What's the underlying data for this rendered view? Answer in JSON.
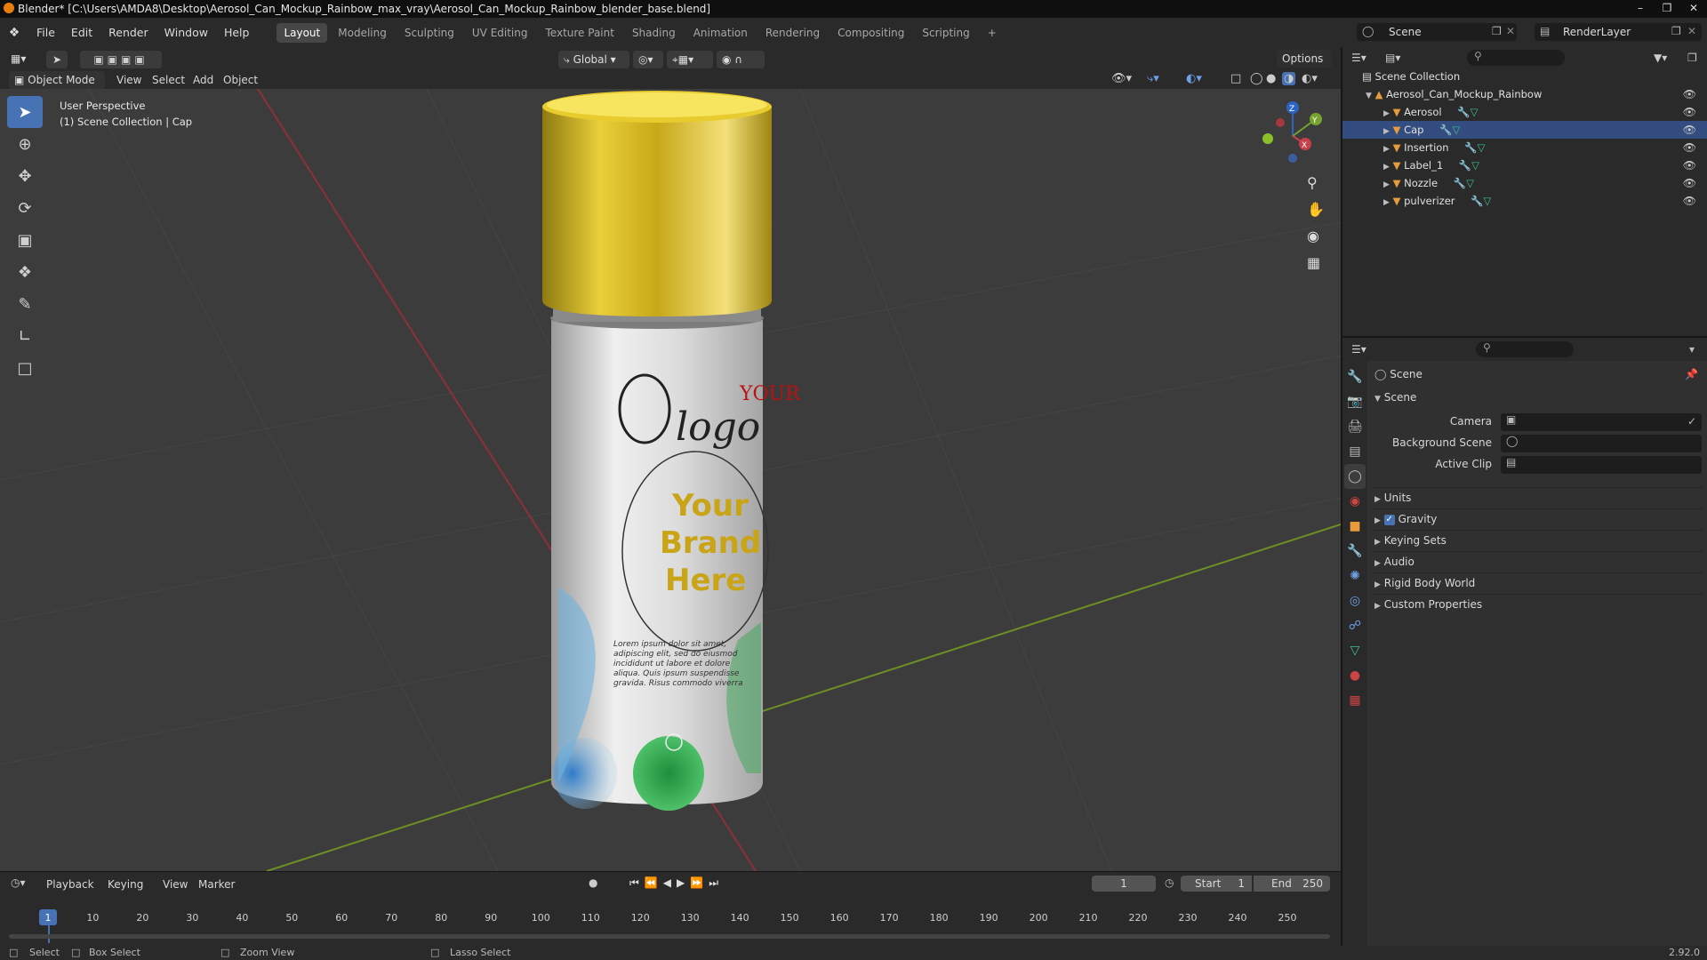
{
  "title_bar": {
    "text": "Blender* [C:\\Users\\AMDA8\\Desktop\\Aerosol_Can_Mockup_Rainbow_max_vray\\Aerosol_Can_Mockup_Rainbow_blender_base.blend]"
  },
  "menu": {
    "items": [
      "File",
      "Edit",
      "Render",
      "Window",
      "Help"
    ]
  },
  "workspaces": [
    "Layout",
    "Modeling",
    "Sculpting",
    "UV Editing",
    "Texture Paint",
    "Shading",
    "Animation",
    "Rendering",
    "Compositing",
    "Scripting",
    "+"
  ],
  "top_right": {
    "scene": "Scene",
    "view_layer": "RenderLayer"
  },
  "viewport_header": {
    "mode": "Object Mode",
    "menus": [
      "View",
      "Select",
      "Add",
      "Object"
    ],
    "transform_orientation": "Global",
    "options": "Options"
  },
  "viewport": {
    "perspective": "User Perspective",
    "collection_info": "(1) Scene Collection | Cap",
    "label_text": {
      "logo_line1": "YOUR",
      "logo_line2": "logo",
      "brand_line1": "Your",
      "brand_line2": "Brand",
      "brand_line3": "Here",
      "lorem": "Lorem ipsum dolor sit amet, adipiscing elit, sed do eiusmod incididunt ut labore et dolore aliqua. Quis ipsum suspendisse gravida. Risus commodo viverra"
    },
    "gizmo": {
      "z": "Z",
      "y": "Y",
      "x": "X"
    }
  },
  "outliner": {
    "root": "Scene Collection",
    "collection": "Aerosol_Can_Mockup_Rainbow",
    "objects": [
      "Aerosol",
      "Cap",
      "Insertion",
      "Label_1",
      "Nozzle",
      "pulverizer"
    ]
  },
  "properties": {
    "header": "Scene",
    "section": "Scene",
    "fields": [
      {
        "label": "Camera"
      },
      {
        "label": "Background Scene"
      },
      {
        "label": "Active Clip"
      }
    ],
    "panels": [
      "Units",
      "Gravity",
      "Keying Sets",
      "Audio",
      "Rigid Body World",
      "Custom Properties"
    ],
    "gravity_checked": true
  },
  "timeline": {
    "menus": [
      "Playback",
      "Keying",
      "View",
      "Marker"
    ],
    "current_frame": "1",
    "start_label": "Start",
    "start": "1",
    "end_label": "End",
    "end": "250",
    "ticks": [
      "1",
      "10",
      "20",
      "30",
      "40",
      "50",
      "60",
      "70",
      "80",
      "90",
      "100",
      "110",
      "120",
      "130",
      "140",
      "150",
      "160",
      "170",
      "180",
      "190",
      "200",
      "210",
      "220",
      "230",
      "240",
      "250"
    ]
  },
  "status_bar": {
    "select": "Select",
    "box_select": "Box Select",
    "zoom_view": "Zoom View",
    "lasso_select": "Lasso Select",
    "version": "2.92.0"
  },
  "colors": {
    "accent": "#4772b3",
    "cap": "#d4b520",
    "x_axis": "#b83a44",
    "y_axis": "#7fa62a"
  }
}
